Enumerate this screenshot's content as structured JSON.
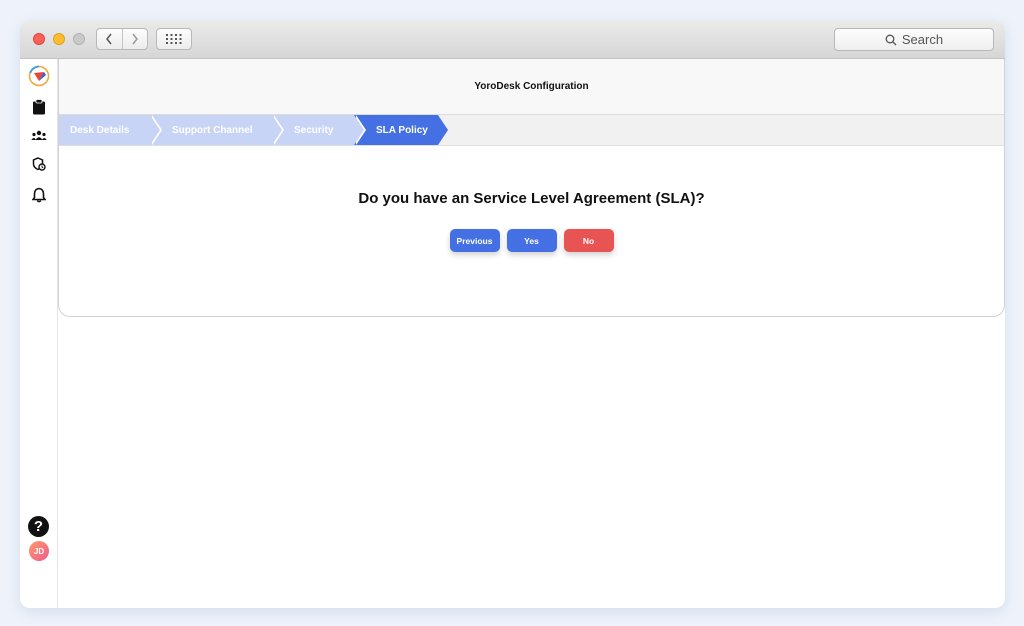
{
  "toolbar": {
    "search_placeholder": "Search"
  },
  "header": {
    "title": "YoroDesk Configuration"
  },
  "steps": [
    {
      "label": "Desk Details",
      "state": "completed"
    },
    {
      "label": "Support Channel",
      "state": "completed"
    },
    {
      "label": "Security",
      "state": "completed"
    },
    {
      "label": "SLA Policy",
      "state": "active"
    }
  ],
  "main": {
    "question": "Do you have an Service Level Agreement (SLA)?",
    "previous_label": "Previous",
    "yes_label": "Yes",
    "no_label": "No"
  },
  "sidebar": {
    "icons": [
      "logo-icon",
      "clipboard-icon",
      "team-icon",
      "sla-icon",
      "bell-icon"
    ],
    "help_label": "?",
    "avatar_initials": "JD"
  },
  "colors": {
    "primary": "#4470e3",
    "danger": "#e85353",
    "step_light": "#c7d4f6",
    "step_active": "#4470e3"
  }
}
